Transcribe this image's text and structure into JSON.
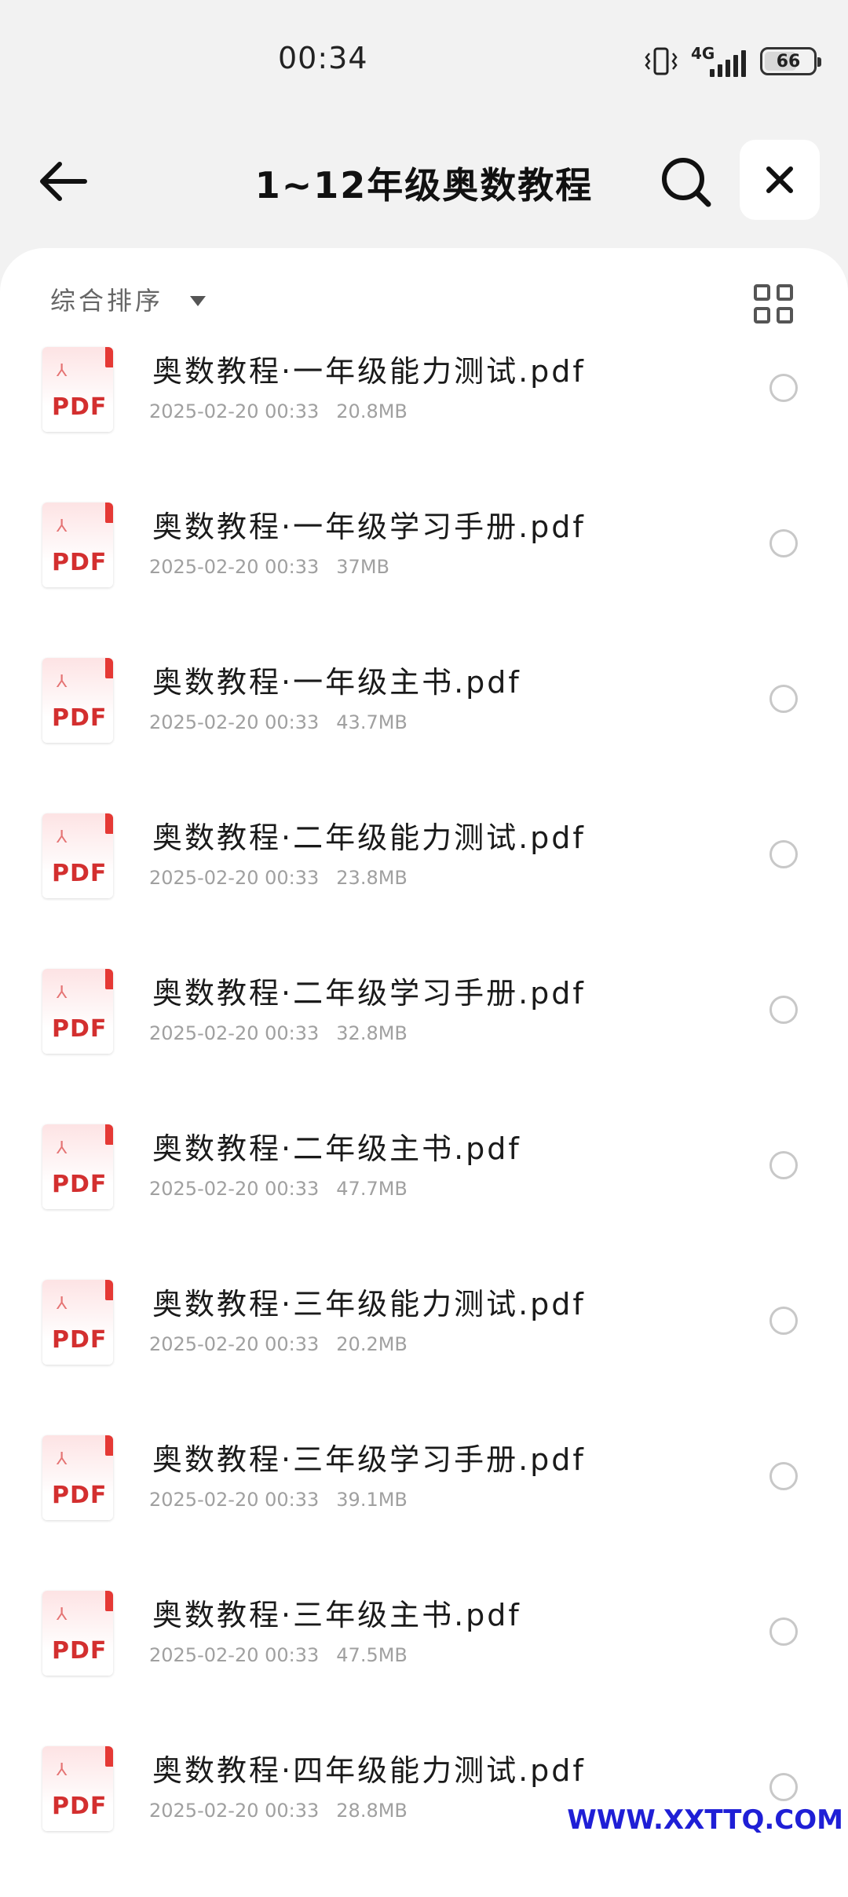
{
  "status_bar": {
    "time": "00:34",
    "network": "4G",
    "battery": "66",
    "battery_level": 0.66
  },
  "header": {
    "title": "1~12年级奥数教程"
  },
  "toolbar": {
    "sort_label": "综合排序"
  },
  "files": [
    {
      "name": "奥数教程·一年级能力测试.pdf",
      "date": "2025-02-20 00:33",
      "size": "20.8MB"
    },
    {
      "name": "奥数教程·一年级学习手册.pdf",
      "date": "2025-02-20 00:33",
      "size": "37MB"
    },
    {
      "name": "奥数教程·一年级主书.pdf",
      "date": "2025-02-20 00:33",
      "size": "43.7MB"
    },
    {
      "name": "奥数教程·二年级能力测试.pdf",
      "date": "2025-02-20 00:33",
      "size": "23.8MB"
    },
    {
      "name": "奥数教程·二年级学习手册.pdf",
      "date": "2025-02-20 00:33",
      "size": "32.8MB"
    },
    {
      "name": "奥数教程·二年级主书.pdf",
      "date": "2025-02-20 00:33",
      "size": "47.7MB"
    },
    {
      "name": "奥数教程·三年级能力测试.pdf",
      "date": "2025-02-20 00:33",
      "size": "20.2MB"
    },
    {
      "name": "奥数教程·三年级学习手册.pdf",
      "date": "2025-02-20 00:33",
      "size": "39.1MB"
    },
    {
      "name": "奥数教程·三年级主书.pdf",
      "date": "2025-02-20 00:33",
      "size": "47.5MB"
    },
    {
      "name": "奥数教程·四年级能力测试.pdf",
      "date": "2025-02-20 00:33",
      "size": "28.8MB"
    }
  ],
  "file_icon_label": "PDF",
  "watermark": "WWW.XXTTQ.COM"
}
